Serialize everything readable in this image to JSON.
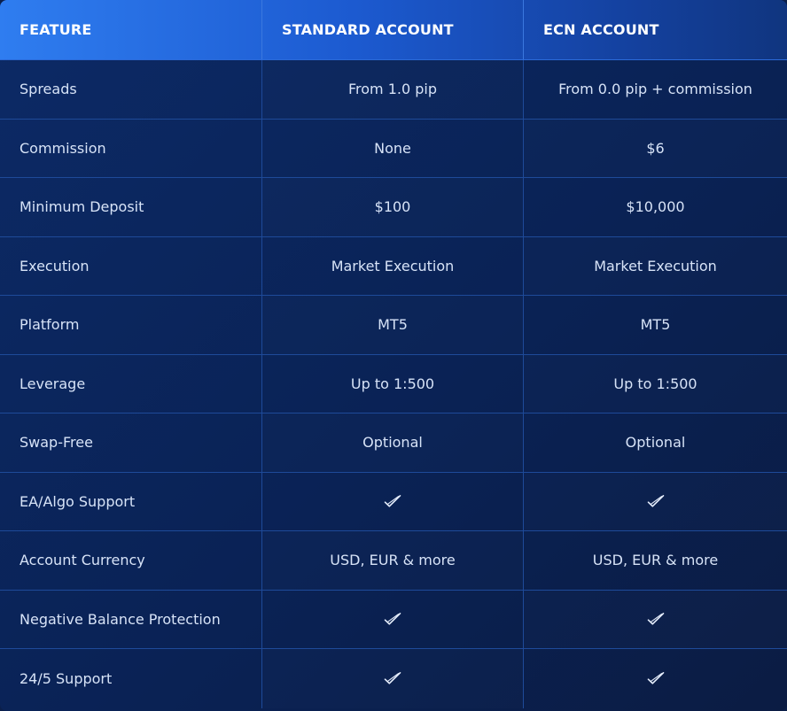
{
  "colors": {
    "header_start": "#2f7df0",
    "header_end": "#10357f",
    "body_bg": "#0c2a66",
    "grid_line": "#1e4a99",
    "text": "#d7e3f7"
  },
  "header": {
    "feature": "FEATURE",
    "standard": "STANDARD ACCOUNT",
    "ecn": "ECN ACCOUNT"
  },
  "rows": [
    {
      "feature": "Spreads",
      "standard": "From 1.0 pip",
      "ecn": "From 0.0 pip + commission"
    },
    {
      "feature": "Commission",
      "standard": "None",
      "ecn": "$6"
    },
    {
      "feature": "Minimum Deposit",
      "standard": "$100",
      "ecn": "$10,000"
    },
    {
      "feature": "Execution",
      "standard": "Market Execution",
      "ecn": "Market Execution"
    },
    {
      "feature": "Platform",
      "standard": "MT5",
      "ecn": "MT5"
    },
    {
      "feature": "Leverage",
      "standard": "Up to 1:500",
      "ecn": "Up to 1:500"
    },
    {
      "feature": "Swap-Free",
      "standard": "Optional",
      "ecn": "Optional"
    },
    {
      "feature": "EA/Algo Support",
      "standard_icon": "check-icon",
      "ecn_icon": "check-icon"
    },
    {
      "feature": "Account Currency",
      "standard": "USD, EUR & more",
      "ecn": "USD, EUR & more"
    },
    {
      "feature": "Negative Balance Protection",
      "standard_icon": "check-icon",
      "ecn_icon": "check-icon"
    },
    {
      "feature": "24/5 Support",
      "standard_icon": "check-icon",
      "ecn_icon": "check-icon"
    }
  ]
}
